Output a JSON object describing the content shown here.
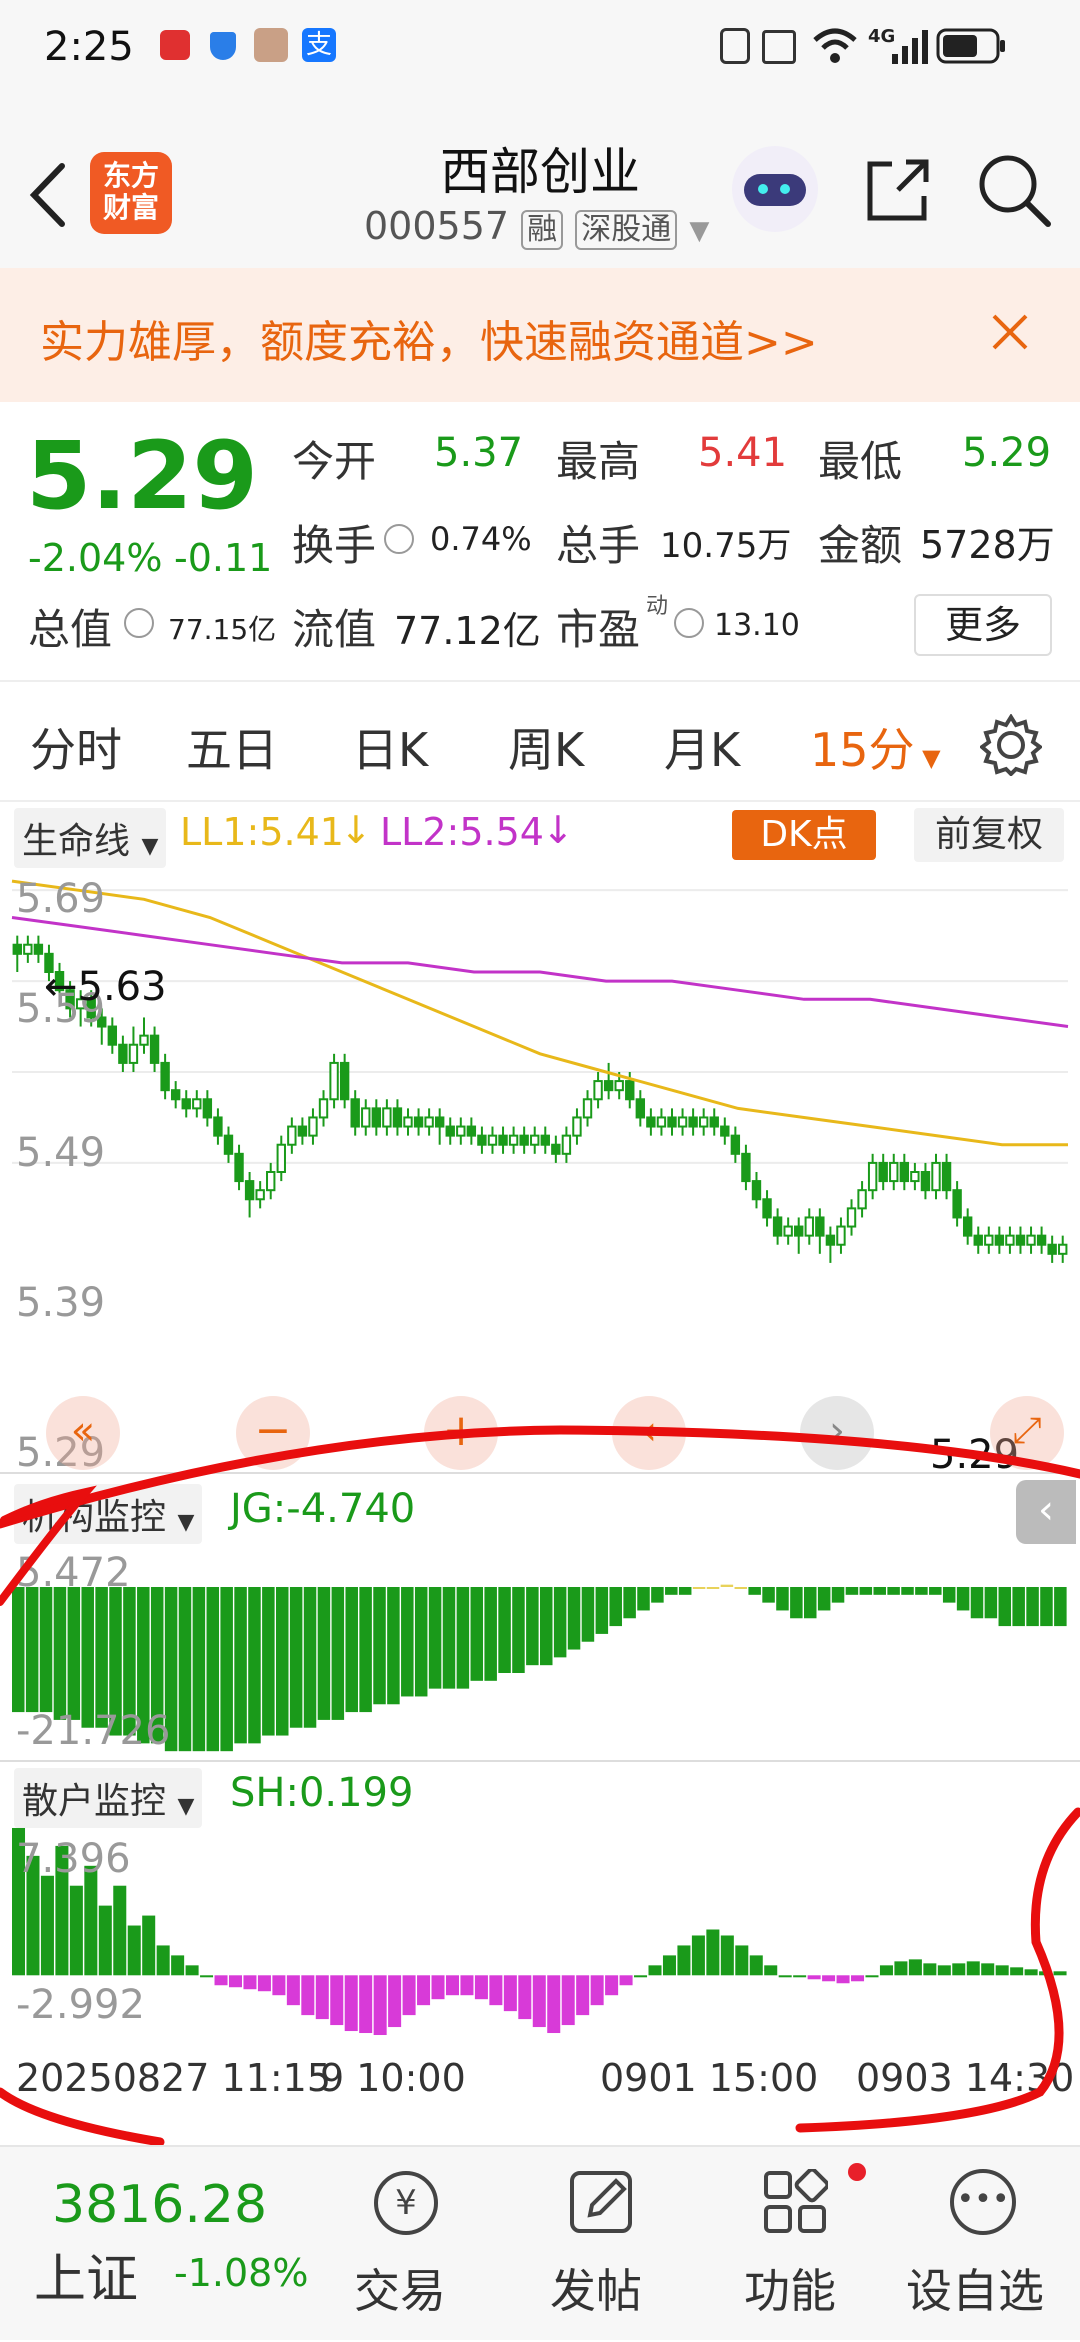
{
  "status": {
    "time": "2:25",
    "network": "4G"
  },
  "header": {
    "logo_text": "东方\n财富",
    "stock_name": "西部创业",
    "stock_code": "000557",
    "tags": [
      "融",
      "深股通"
    ]
  },
  "banner": {
    "text": "实力雄厚，额度充裕，快速融资通道>>"
  },
  "quote": {
    "price": "5.29",
    "change_pct": "-2.04%",
    "change": "-0.11",
    "open_label": "今开",
    "open": "5.37",
    "high_label": "最高",
    "high": "5.41",
    "low_label": "最低",
    "low": "5.29",
    "turnover_label": "换手",
    "turnover": "0.74%",
    "volume_label": "总手",
    "volume": "10.75万",
    "amount_label": "金额",
    "amount": "5728万",
    "mktcap_label": "总值",
    "mktcap": "77.15亿",
    "float_label": "流值",
    "float": "77.12亿",
    "pe_label": "市盈",
    "pe_sup": "动",
    "pe": "13.10",
    "more_label": "更多"
  },
  "tabs": [
    "分时",
    "五日",
    "日K",
    "周K",
    "月K",
    "15分"
  ],
  "active_tab": "15分",
  "main_chart": {
    "indicator_name": "生命线",
    "ll1": "LL1:5.41",
    "ll2": "LL2:5.54",
    "dk_label": "DK点",
    "adjust_label": "前复权",
    "y_labels": [
      "5.69",
      "5.59",
      "5.49",
      "5.39",
      "5.29"
    ],
    "high_marker": "←5.63",
    "low_marker": "5.29"
  },
  "panel1": {
    "name": "机构监控",
    "value": "JG:-4.740",
    "top": "5.472",
    "bottom": "-21.726"
  },
  "panel2": {
    "name": "散户监控",
    "value": "SH:0.199",
    "top": "7.396",
    "bottom": "-2.992"
  },
  "time_axis": [
    "20250827 11:15",
    "9 10:00",
    "0901 15:00",
    "0903 14:30"
  ],
  "bottomnav": {
    "index_value": "3816.28",
    "index_name": "上证",
    "index_change": "-1.08%",
    "items": [
      "交易",
      "发帖",
      "功能",
      "设自选"
    ]
  },
  "colors": {
    "up": "#e23b3b",
    "down": "#1a9a1a",
    "accent": "#e8650f",
    "ll1": "#e8b81a",
    "ll2": "#c233c8"
  },
  "chart_data": {
    "type": "candlestick",
    "candles": [
      [
        5.63,
        5.62,
        5.64,
        5.6
      ],
      [
        5.62,
        5.63,
        5.64,
        5.61
      ],
      [
        5.63,
        5.62,
        5.64,
        5.61
      ],
      [
        5.62,
        5.6,
        5.63,
        5.59
      ],
      [
        5.6,
        5.58,
        5.61,
        5.57
      ],
      [
        5.58,
        5.56,
        5.59,
        5.55
      ],
      [
        5.56,
        5.57,
        5.58,
        5.54
      ],
      [
        5.57,
        5.55,
        5.58,
        5.54
      ],
      [
        5.55,
        5.54,
        5.56,
        5.52
      ],
      [
        5.54,
        5.52,
        5.55,
        5.51
      ],
      [
        5.52,
        5.5,
        5.53,
        5.49
      ],
      [
        5.5,
        5.52,
        5.54,
        5.49
      ],
      [
        5.52,
        5.53,
        5.55,
        5.51
      ],
      [
        5.53,
        5.5,
        5.54,
        5.49
      ],
      [
        5.5,
        5.47,
        5.51,
        5.46
      ],
      [
        5.47,
        5.46,
        5.48,
        5.45
      ],
      [
        5.46,
        5.45,
        5.47,
        5.44
      ],
      [
        5.45,
        5.46,
        5.47,
        5.44
      ],
      [
        5.46,
        5.44,
        5.47,
        5.43
      ],
      [
        5.44,
        5.42,
        5.45,
        5.41
      ],
      [
        5.42,
        5.4,
        5.43,
        5.39
      ],
      [
        5.4,
        5.37,
        5.41,
        5.36
      ],
      [
        5.37,
        5.35,
        5.38,
        5.33
      ],
      [
        5.35,
        5.36,
        5.37,
        5.34
      ],
      [
        5.36,
        5.38,
        5.39,
        5.35
      ],
      [
        5.38,
        5.41,
        5.42,
        5.37
      ],
      [
        5.41,
        5.43,
        5.44,
        5.4
      ],
      [
        5.43,
        5.42,
        5.44,
        5.41
      ],
      [
        5.42,
        5.44,
        5.45,
        5.41
      ],
      [
        5.44,
        5.46,
        5.47,
        5.43
      ],
      [
        5.46,
        5.5,
        5.51,
        5.45
      ],
      [
        5.5,
        5.46,
        5.51,
        5.45
      ],
      [
        5.46,
        5.43,
        5.47,
        5.42
      ],
      [
        5.43,
        5.45,
        5.46,
        5.42
      ],
      [
        5.45,
        5.43,
        5.46,
        5.42
      ],
      [
        5.43,
        5.45,
        5.46,
        5.42
      ],
      [
        5.45,
        5.43,
        5.46,
        5.42
      ],
      [
        5.43,
        5.44,
        5.45,
        5.42
      ],
      [
        5.44,
        5.43,
        5.45,
        5.42
      ],
      [
        5.43,
        5.44,
        5.45,
        5.42
      ],
      [
        5.44,
        5.43,
        5.45,
        5.41
      ],
      [
        5.43,
        5.42,
        5.44,
        5.41
      ],
      [
        5.42,
        5.43,
        5.44,
        5.41
      ],
      [
        5.43,
        5.42,
        5.44,
        5.41
      ],
      [
        5.42,
        5.41,
        5.43,
        5.4
      ],
      [
        5.41,
        5.42,
        5.43,
        5.4
      ],
      [
        5.42,
        5.41,
        5.43,
        5.4
      ],
      [
        5.41,
        5.42,
        5.43,
        5.4
      ],
      [
        5.42,
        5.41,
        5.43,
        5.4
      ],
      [
        5.41,
        5.42,
        5.43,
        5.4
      ],
      [
        5.42,
        5.41,
        5.43,
        5.4
      ],
      [
        5.41,
        5.4,
        5.42,
        5.39
      ],
      [
        5.4,
        5.42,
        5.43,
        5.39
      ],
      [
        5.42,
        5.44,
        5.45,
        5.41
      ],
      [
        5.44,
        5.46,
        5.47,
        5.43
      ],
      [
        5.46,
        5.48,
        5.49,
        5.45
      ],
      [
        5.48,
        5.47,
        5.5,
        5.46
      ],
      [
        5.47,
        5.48,
        5.49,
        5.46
      ],
      [
        5.48,
        5.46,
        5.49,
        5.45
      ],
      [
        5.46,
        5.44,
        5.47,
        5.43
      ],
      [
        5.44,
        5.43,
        5.45,
        5.42
      ],
      [
        5.43,
        5.44,
        5.45,
        5.42
      ],
      [
        5.44,
        5.43,
        5.45,
        5.42
      ],
      [
        5.43,
        5.44,
        5.45,
        5.42
      ],
      [
        5.44,
        5.43,
        5.45,
        5.42
      ],
      [
        5.43,
        5.44,
        5.45,
        5.42
      ],
      [
        5.44,
        5.43,
        5.45,
        5.42
      ],
      [
        5.43,
        5.42,
        5.44,
        5.41
      ],
      [
        5.42,
        5.4,
        5.43,
        5.39
      ],
      [
        5.4,
        5.37,
        5.41,
        5.36
      ],
      [
        5.37,
        5.35,
        5.38,
        5.34
      ],
      [
        5.35,
        5.33,
        5.36,
        5.32
      ],
      [
        5.33,
        5.31,
        5.34,
        5.3
      ],
      [
        5.31,
        5.32,
        5.33,
        5.3
      ],
      [
        5.32,
        5.31,
        5.33,
        5.29
      ],
      [
        5.31,
        5.33,
        5.34,
        5.3
      ],
      [
        5.33,
        5.31,
        5.34,
        5.29
      ],
      [
        5.31,
        5.3,
        5.32,
        5.28
      ],
      [
        5.3,
        5.32,
        5.33,
        5.29
      ],
      [
        5.32,
        5.34,
        5.35,
        5.31
      ],
      [
        5.34,
        5.36,
        5.37,
        5.33
      ],
      [
        5.36,
        5.39,
        5.4,
        5.35
      ],
      [
        5.39,
        5.37,
        5.4,
        5.36
      ],
      [
        5.37,
        5.39,
        5.4,
        5.36
      ],
      [
        5.39,
        5.37,
        5.4,
        5.36
      ],
      [
        5.37,
        5.38,
        5.39,
        5.36
      ],
      [
        5.38,
        5.36,
        5.39,
        5.35
      ],
      [
        5.36,
        5.39,
        5.4,
        5.35
      ],
      [
        5.39,
        5.36,
        5.4,
        5.35
      ],
      [
        5.36,
        5.33,
        5.37,
        5.32
      ],
      [
        5.33,
        5.31,
        5.34,
        5.3
      ],
      [
        5.31,
        5.3,
        5.32,
        5.29
      ],
      [
        5.3,
        5.31,
        5.32,
        5.29
      ],
      [
        5.31,
        5.3,
        5.32,
        5.29
      ],
      [
        5.3,
        5.31,
        5.32,
        5.29
      ],
      [
        5.31,
        5.3,
        5.32,
        5.29
      ],
      [
        5.3,
        5.31,
        5.32,
        5.29
      ],
      [
        5.31,
        5.3,
        5.32,
        5.29
      ],
      [
        5.3,
        5.29,
        5.31,
        5.28
      ],
      [
        5.29,
        5.3,
        5.31,
        5.28
      ]
    ],
    "ll1_values": [
      5.7,
      5.69,
      5.68,
      5.66,
      5.63,
      5.6,
      5.57,
      5.54,
      5.51,
      5.49,
      5.47,
      5.45,
      5.44,
      5.43,
      5.42,
      5.41,
      5.41
    ],
    "ll2_values": [
      5.66,
      5.65,
      5.64,
      5.63,
      5.62,
      5.61,
      5.61,
      5.6,
      5.6,
      5.59,
      5.59,
      5.58,
      5.57,
      5.57,
      5.56,
      5.55,
      5.54
    ],
    "jg_values": [
      -16,
      -16,
      -16,
      -17,
      -17,
      -18,
      -18,
      -19,
      -19,
      -20,
      -20,
      -21,
      -21,
      -21,
      -21,
      -21,
      -20,
      -20,
      -19,
      -19,
      -18,
      -18,
      -17,
      -17,
      -16,
      -16,
      -15,
      -15,
      -14,
      -14,
      -13,
      -13,
      -13,
      -12,
      -12,
      -11,
      -11,
      -10,
      -10,
      -9,
      -8,
      -7,
      -6,
      -5,
      -4,
      -3,
      -2,
      -1,
      -1,
      0,
      0,
      0.3,
      0,
      -1,
      -2,
      -3,
      -4,
      -4,
      -3,
      -2,
      -1,
      -1,
      -1,
      -1,
      -1,
      -1,
      -1,
      -2,
      -3,
      -4,
      -4,
      -5,
      -5,
      -5,
      -5,
      -5
    ],
    "sh_values": [
      7.4,
      6.0,
      5.0,
      6.5,
      4.5,
      5.5,
      3.5,
      4.5,
      2.5,
      3.0,
      1.5,
      1.0,
      0.5,
      0,
      -0.5,
      -0.6,
      -0.7,
      -0.8,
      -1.0,
      -1.5,
      -2.0,
      -2.2,
      -2.5,
      -2.8,
      -2.9,
      -3.0,
      -2.6,
      -2.0,
      -1.5,
      -1.2,
      -1.0,
      -1.0,
      -1.2,
      -1.5,
      -1.8,
      -2.2,
      -2.6,
      -2.9,
      -2.5,
      -2.0,
      -1.5,
      -1.0,
      -0.5,
      0,
      0.5,
      1.0,
      1.5,
      2.0,
      2.3,
      2.0,
      1.5,
      1.0,
      0.5,
      0,
      0,
      -0.2,
      -0.3,
      -0.4,
      -0.3,
      0,
      0.5,
      0.7,
      0.8,
      0.6,
      0.5,
      0.6,
      0.7,
      0.6,
      0.5,
      0.4,
      0.3,
      0.2,
      0.2
    ]
  }
}
